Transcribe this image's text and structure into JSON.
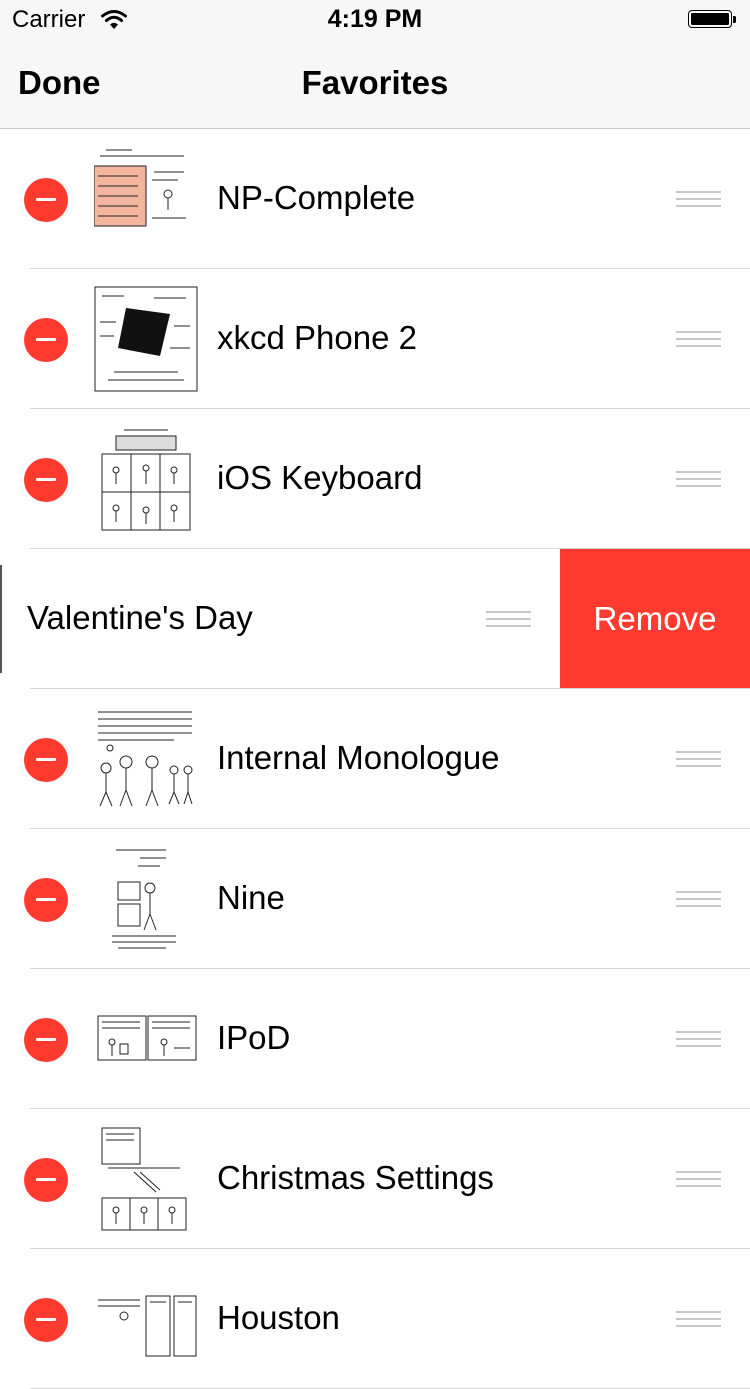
{
  "status_bar": {
    "carrier": "Carrier",
    "time": "4:19 PM"
  },
  "nav": {
    "done_label": "Done",
    "title": "Favorites"
  },
  "accent_delete_color": "#ff3b30",
  "items": [
    {
      "title": "NP-Complete"
    },
    {
      "title": "xkcd Phone 2"
    },
    {
      "title": "iOS Keyboard"
    },
    {
      "title": "Valentine's Day",
      "swiped": true,
      "action_label": "Remove"
    },
    {
      "title": "Internal Monologue"
    },
    {
      "title": "Nine"
    },
    {
      "title": "IPoD"
    },
    {
      "title": "Christmas Settings"
    },
    {
      "title": "Houston"
    }
  ]
}
